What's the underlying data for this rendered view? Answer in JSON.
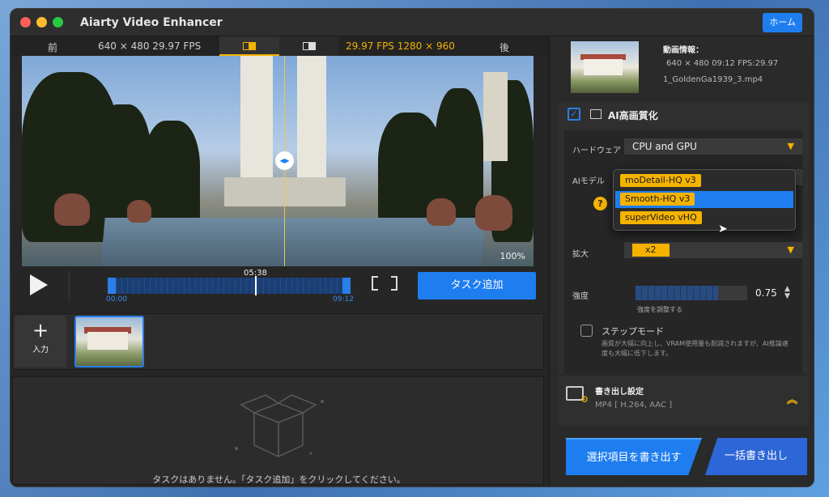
{
  "app": {
    "title": "Aiarty Video Enhancer",
    "home_label": "ホーム"
  },
  "preview": {
    "before_label": "前",
    "before_info": "640 × 480  29.97 FPS",
    "after_info": "29.97 FPS  1280 × 960",
    "after_label": "後",
    "zoom": "100%"
  },
  "timeline": {
    "current": "05:38",
    "start": "00:00",
    "end": "09:12",
    "add_task_label": "タスク追加"
  },
  "clips": {
    "input_label": "入力"
  },
  "tasks": {
    "empty_message": "タスクはありません。「タスク追加」をクリックしてください。"
  },
  "video_info": {
    "title": "動画情報：",
    "line1": "640 × 480 09:12 FPS:29.97",
    "filename": "1_GoldenGa1939_3.mp4"
  },
  "ai": {
    "enabled": true,
    "title": "AI高画質化",
    "hardware_label": "ハードウェア",
    "hardware_value": "CPU and GPU",
    "model_label": "AIモデル",
    "model_options": [
      "moDetail-HQ  v3",
      "Smooth-HQ  v3",
      "superVideo vHQ"
    ],
    "selected_model_index": 1,
    "scale_label": "拡大",
    "scale_value": "x2",
    "strength_label": "強度",
    "strength_value": "0.75",
    "strength_hint": "強度を調整する",
    "step_mode_label": "ステップモード",
    "step_mode_desc": "画質が大幅に向上し、VRAM使用量も削減されますが、AI推論速度も大幅に低下します。"
  },
  "export": {
    "settings_title": "書き出し設定",
    "format": "MP4 [ H.264, AAC ]",
    "export_selected_label": "選択項目を書き出す",
    "export_all_label": "一括書き出し"
  },
  "colors": {
    "accent": "#1e7ef0",
    "highlight": "#f5b300"
  }
}
